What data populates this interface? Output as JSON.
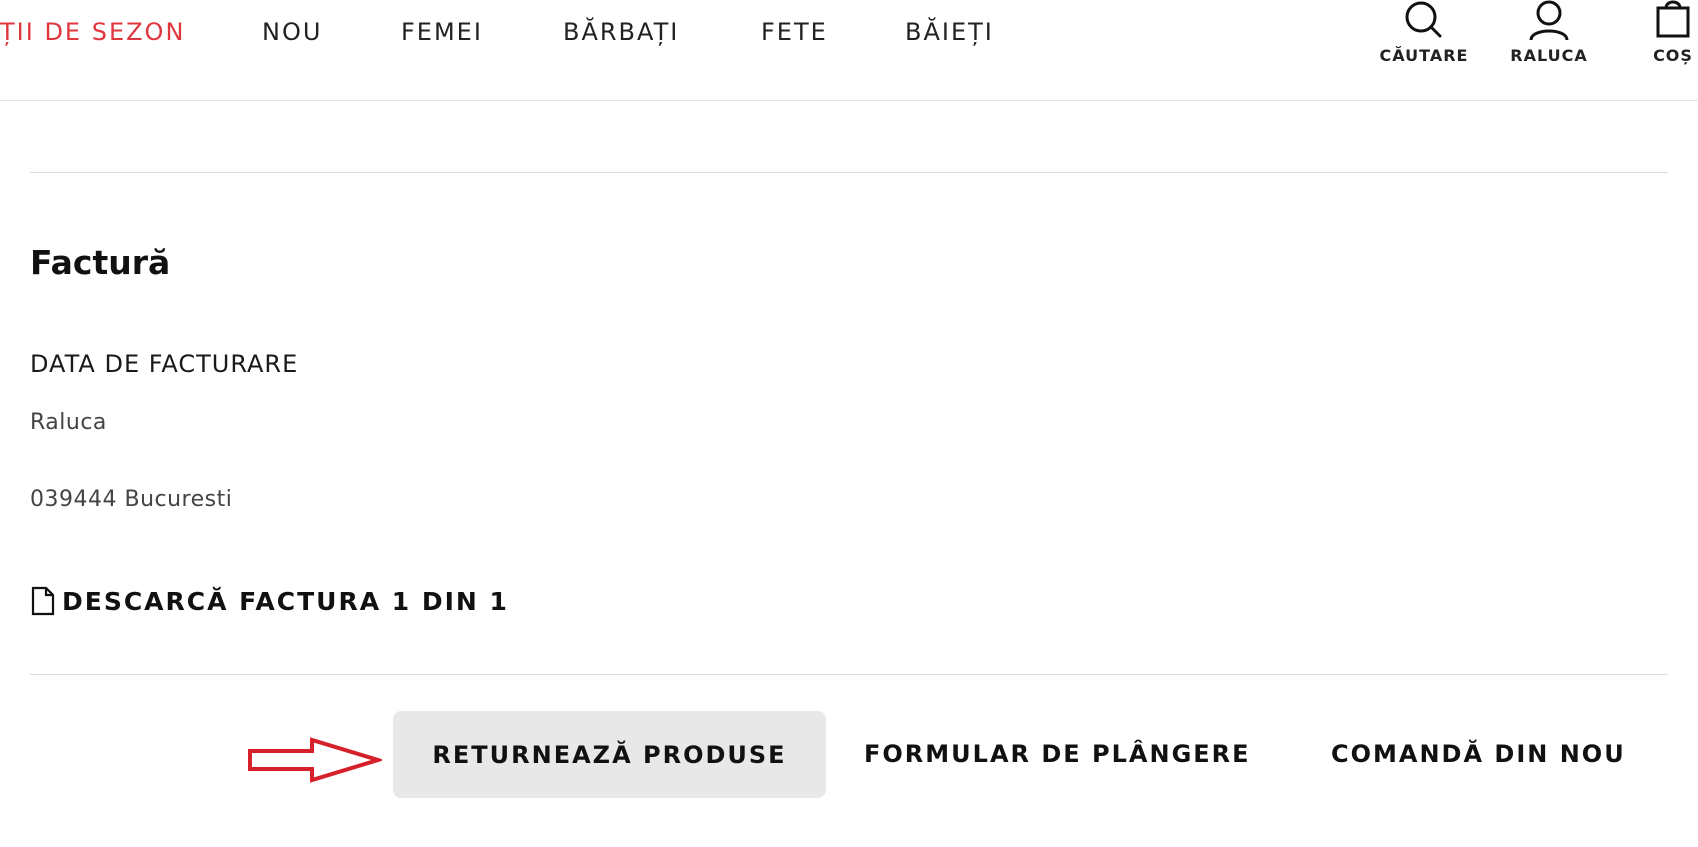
{
  "nav": {
    "items": [
      "ȚII DE SEZON",
      "NOU",
      "FEMEI",
      "BĂRBAȚI",
      "FETE",
      "BĂIEȚI"
    ],
    "utility": {
      "search_label": "CĂUTARE",
      "account_label": "RALUCA",
      "cart_label": "COȘ"
    }
  },
  "invoice": {
    "title": "Factură",
    "billing_heading": "DATA DE FACTURARE",
    "name": "Raluca",
    "address": "039444 Bucuresti",
    "download_label": "DESCARCĂ FACTURA 1 DIN 1"
  },
  "actions": {
    "return_label": "RETURNEAZĂ PRODUSE",
    "complaint_label": "FORMULAR DE PLÂNGERE",
    "reorder_label": "COMANDĂ DIN NOU"
  },
  "colors": {
    "sale": "#e0363e",
    "annotation_arrow": "#d6202a",
    "primary_button_bg": "#e8e8e8"
  },
  "icons": {
    "search": "search-icon",
    "account": "user-icon",
    "cart": "bag-icon",
    "download": "document-icon",
    "annotation": "arrow-right-icon"
  }
}
